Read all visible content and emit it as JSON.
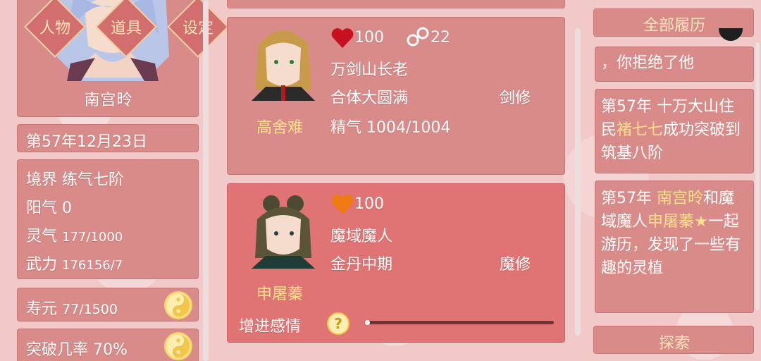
{
  "player": {
    "name": "南宫昤",
    "date": "第57年12月23日",
    "realm_label": "境界",
    "realm_value": "练气七阶",
    "yang_label": "阳气",
    "yang_value": "0",
    "spirit_label": "灵气",
    "spirit_value": "177/1000",
    "force_label": "武力",
    "force_value": "176156/7",
    "lifespan_label": "寿元",
    "lifespan_value": "77/1500",
    "breakthrough_label": "突破几率",
    "breakthrough_value": "70%"
  },
  "nav": {
    "character": "人物",
    "items": "道具",
    "settings": "设定"
  },
  "cards": [
    {
      "name": "高舍难",
      "affection": "100",
      "bond": "22",
      "title": "万剑山长老",
      "realm": "合体大圆满",
      "path": "剑修",
      "essence_label": "精气",
      "essence_value": "1004/1004",
      "heart_color": "#c8101e"
    },
    {
      "name": "申屠蓁",
      "affection": "100",
      "title": "魔域魔人",
      "realm": "金丹中期",
      "path": "魔修",
      "action_label": "增进感情",
      "heart_color": "#f07a12"
    }
  ],
  "history": {
    "header": "全部履历",
    "entries": [
      {
        "parts": [
          {
            "t": "，你拒绝了他",
            "c": "w"
          }
        ]
      },
      {
        "parts": [
          {
            "t": "第57年 十万大山住民",
            "c": "w"
          },
          {
            "t": "褚七七",
            "c": "g"
          },
          {
            "t": "成功突破到筑基八阶",
            "c": "w"
          }
        ]
      },
      {
        "parts": [
          {
            "t": "第57年 ",
            "c": "w"
          },
          {
            "t": "南宫昤",
            "c": "g"
          },
          {
            "t": "和魔域魔人",
            "c": "w"
          },
          {
            "t": "申屠蓁",
            "c": "g"
          },
          {
            "t": "★",
            "c": "g"
          },
          {
            "t": "一起游历，发现了一些有趣的灵植",
            "c": "w"
          }
        ]
      }
    ],
    "explore": "探索"
  },
  "colors": {
    "panel": "#d98b8a",
    "gold_text": "#ffe08c",
    "yinyang": "#f8e28b"
  }
}
